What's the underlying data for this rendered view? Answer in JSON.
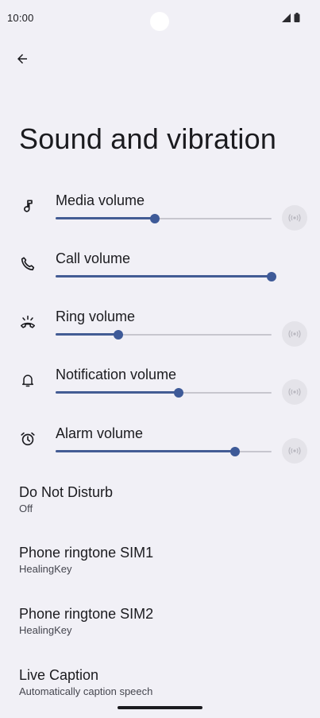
{
  "status_bar": {
    "time": "10:00",
    "icons": [
      "signal-icon",
      "battery-icon"
    ]
  },
  "header": {
    "back_icon": "arrow-back-icon",
    "title": "Sound and vibration"
  },
  "volumes": [
    {
      "key": "media",
      "label": "Media volume",
      "icon": "music-note-icon",
      "level_fraction": 0.46,
      "has_vibrate_toggle": true
    },
    {
      "key": "call",
      "label": "Call volume",
      "icon": "phone-icon",
      "level_fraction": 1.0,
      "has_vibrate_toggle": false
    },
    {
      "key": "ring",
      "label": "Ring volume",
      "icon": "ring-phone-icon",
      "level_fraction": 0.29,
      "has_vibrate_toggle": true
    },
    {
      "key": "notification",
      "label": "Notification volume",
      "icon": "bell-icon",
      "level_fraction": 0.57,
      "has_vibrate_toggle": true
    },
    {
      "key": "alarm",
      "label": "Alarm volume",
      "icon": "alarm-clock-icon",
      "level_fraction": 0.83,
      "has_vibrate_toggle": true
    }
  ],
  "vibrate_icon": "vibrate-icon",
  "preferences": [
    {
      "key": "dnd",
      "title": "Do Not Disturb",
      "summary": "Off"
    },
    {
      "key": "ringtone-sim1",
      "title": "Phone ringtone SIM1",
      "summary": "HealingKey"
    },
    {
      "key": "ringtone-sim2",
      "title": "Phone ringtone SIM2",
      "summary": "HealingKey"
    },
    {
      "key": "live-caption",
      "title": "Live Caption",
      "summary": "Automatically caption speech"
    }
  ],
  "colors": {
    "background": "#f1f0f6",
    "accent": "#3e5a98",
    "track": "#c7c6ce",
    "text_primary": "#1b1b1f",
    "text_secondary": "#45464f"
  }
}
